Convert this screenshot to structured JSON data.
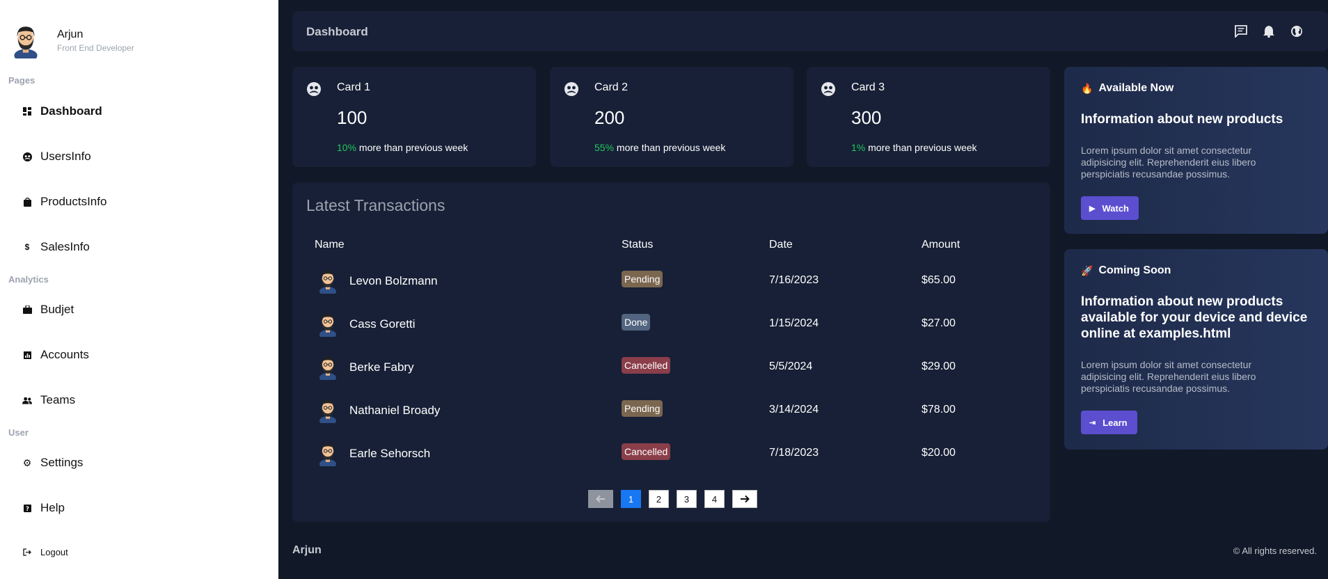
{
  "profile": {
    "name": "Arjun",
    "role": "Front End Developer"
  },
  "sidebar": {
    "sections": [
      "Pages",
      "Analytics",
      "User"
    ],
    "items": [
      {
        "label": "Dashboard",
        "icon": "dashboard-icon"
      },
      {
        "label": "UsersInfo",
        "icon": "users-icon"
      },
      {
        "label": "ProductsInfo",
        "icon": "shopping-bag-icon"
      },
      {
        "label": "SalesInfo",
        "icon": "dollar-icon"
      },
      {
        "label": "Budjet",
        "icon": "briefcase-icon"
      },
      {
        "label": "Accounts",
        "icon": "chart-icon"
      },
      {
        "label": "Teams",
        "icon": "team-icon"
      },
      {
        "label": "Settings",
        "icon": "gear-icon"
      },
      {
        "label": "Help",
        "icon": "help-icon"
      },
      {
        "label": "Logout",
        "icon": "logout-icon"
      }
    ]
  },
  "header": {
    "title": "Dashboard",
    "icons": [
      "message-icon",
      "bell-icon",
      "globe-icon"
    ]
  },
  "cards": [
    {
      "title": "Card 1",
      "value": "100",
      "pct": "10%",
      "note": " more than previous week"
    },
    {
      "title": "Card 2",
      "value": "200",
      "pct": "55%",
      "note": " more than previous week"
    },
    {
      "title": "Card 3",
      "value": "300",
      "pct": "1%",
      "note": " more than previous week"
    }
  ],
  "transactions": {
    "title": "Latest Transactions",
    "columns": [
      "Name",
      "Status",
      "Date",
      "Amount"
    ],
    "rows": [
      {
        "name": "Levon Bolzmann",
        "status": "Pending",
        "date": "7/16/2023",
        "amount": "$65.00"
      },
      {
        "name": "Cass Goretti",
        "status": "Done",
        "date": "1/15/2024",
        "amount": "$27.00"
      },
      {
        "name": "Berke Fabry",
        "status": "Cancelled",
        "date": "5/5/2024",
        "amount": "$29.00"
      },
      {
        "name": "Nathaniel Broady",
        "status": "Pending",
        "date": "3/14/2024",
        "amount": "$78.00"
      },
      {
        "name": "Earle Sehorsch",
        "status": "Cancelled",
        "date": "7/18/2023",
        "amount": "$20.00"
      }
    ],
    "pages": [
      "1",
      "2",
      "3",
      "4"
    ],
    "current_page": "1"
  },
  "promo": [
    {
      "emoji": "🔥",
      "heading": "Available Now",
      "title": "Information about new products",
      "text": "Lorem ipsum dolor sit amet consectetur adipisicing elit. Reprehenderit eius libero perspiciatis recusandae possimus.",
      "button": "Watch",
      "button_icon": "▶"
    },
    {
      "emoji": "🚀",
      "heading": "Coming Soon",
      "title": "Information about new products available for your device and device online at examples.html",
      "text": "Lorem ipsum dolor sit amet consectetur adipisicing elit. Reprehenderit eius libero perspiciatis recusandae possimus.",
      "button": "Learn",
      "button_icon": "⇥"
    }
  ],
  "footer": {
    "brand": "Arjun",
    "copyright": "© All rights reserved."
  },
  "colors": {
    "accent": "#5b4fd0",
    "positive": "#22c55e",
    "page_active": "#1877f2"
  }
}
